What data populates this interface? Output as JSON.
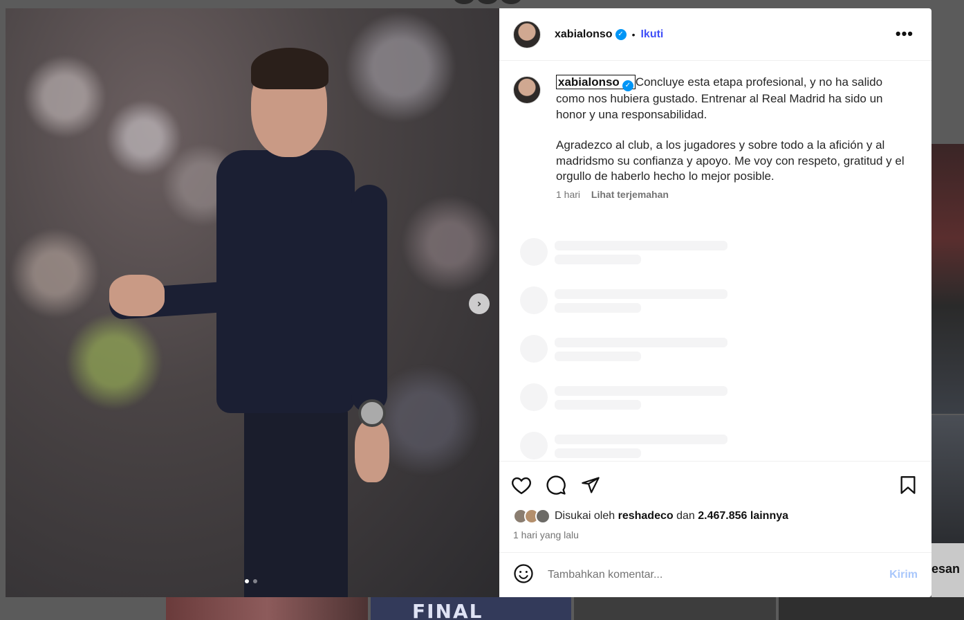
{
  "post": {
    "username": "xabialonso",
    "verified": true,
    "follow_label": "Ikuti",
    "bullet": "•",
    "more_label": "•••"
  },
  "caption": {
    "username": "xabialonso",
    "paragraph1": "Concluye esta etapa profesional, y no ha salido como nos hubiera gustado. Entrenar al Real Madrid ha sido un honor y una responsabilidad.",
    "paragraph2": "Agradezco al club, a los jugadores y sobre todo a la afición y al madridsmo su confianza y apoyo. Me voy con respeto, gratitud y el orgullo de haberlo hecho lo mejor posible.",
    "age": "1 hari",
    "translate_label": "Lihat terjemahan"
  },
  "likes": {
    "prefix": "Disukai oleh",
    "user": "reshadeco",
    "middle": "dan",
    "count": "2.467.856 lainnya",
    "time": "1 hari yang lalu"
  },
  "comment_box": {
    "placeholder": "Tambahkan komentar...",
    "send_label": "Kirim"
  },
  "media": {
    "next_icon": "›",
    "slide_count": 2,
    "current_slide": 1
  },
  "background": {
    "side_text": "esan",
    "tile_text": "FINAL"
  },
  "icons": {
    "like": "heart-icon",
    "comment": "comment-icon",
    "share": "paper-plane-icon",
    "save": "bookmark-icon",
    "emoji": "smiley-icon",
    "verified": "verified-badge-icon"
  },
  "colors": {
    "follow": "#4150f7",
    "verified": "#0095f6",
    "send_disabled": "#a9c7fb",
    "skeleton": "#f4f4f5"
  }
}
